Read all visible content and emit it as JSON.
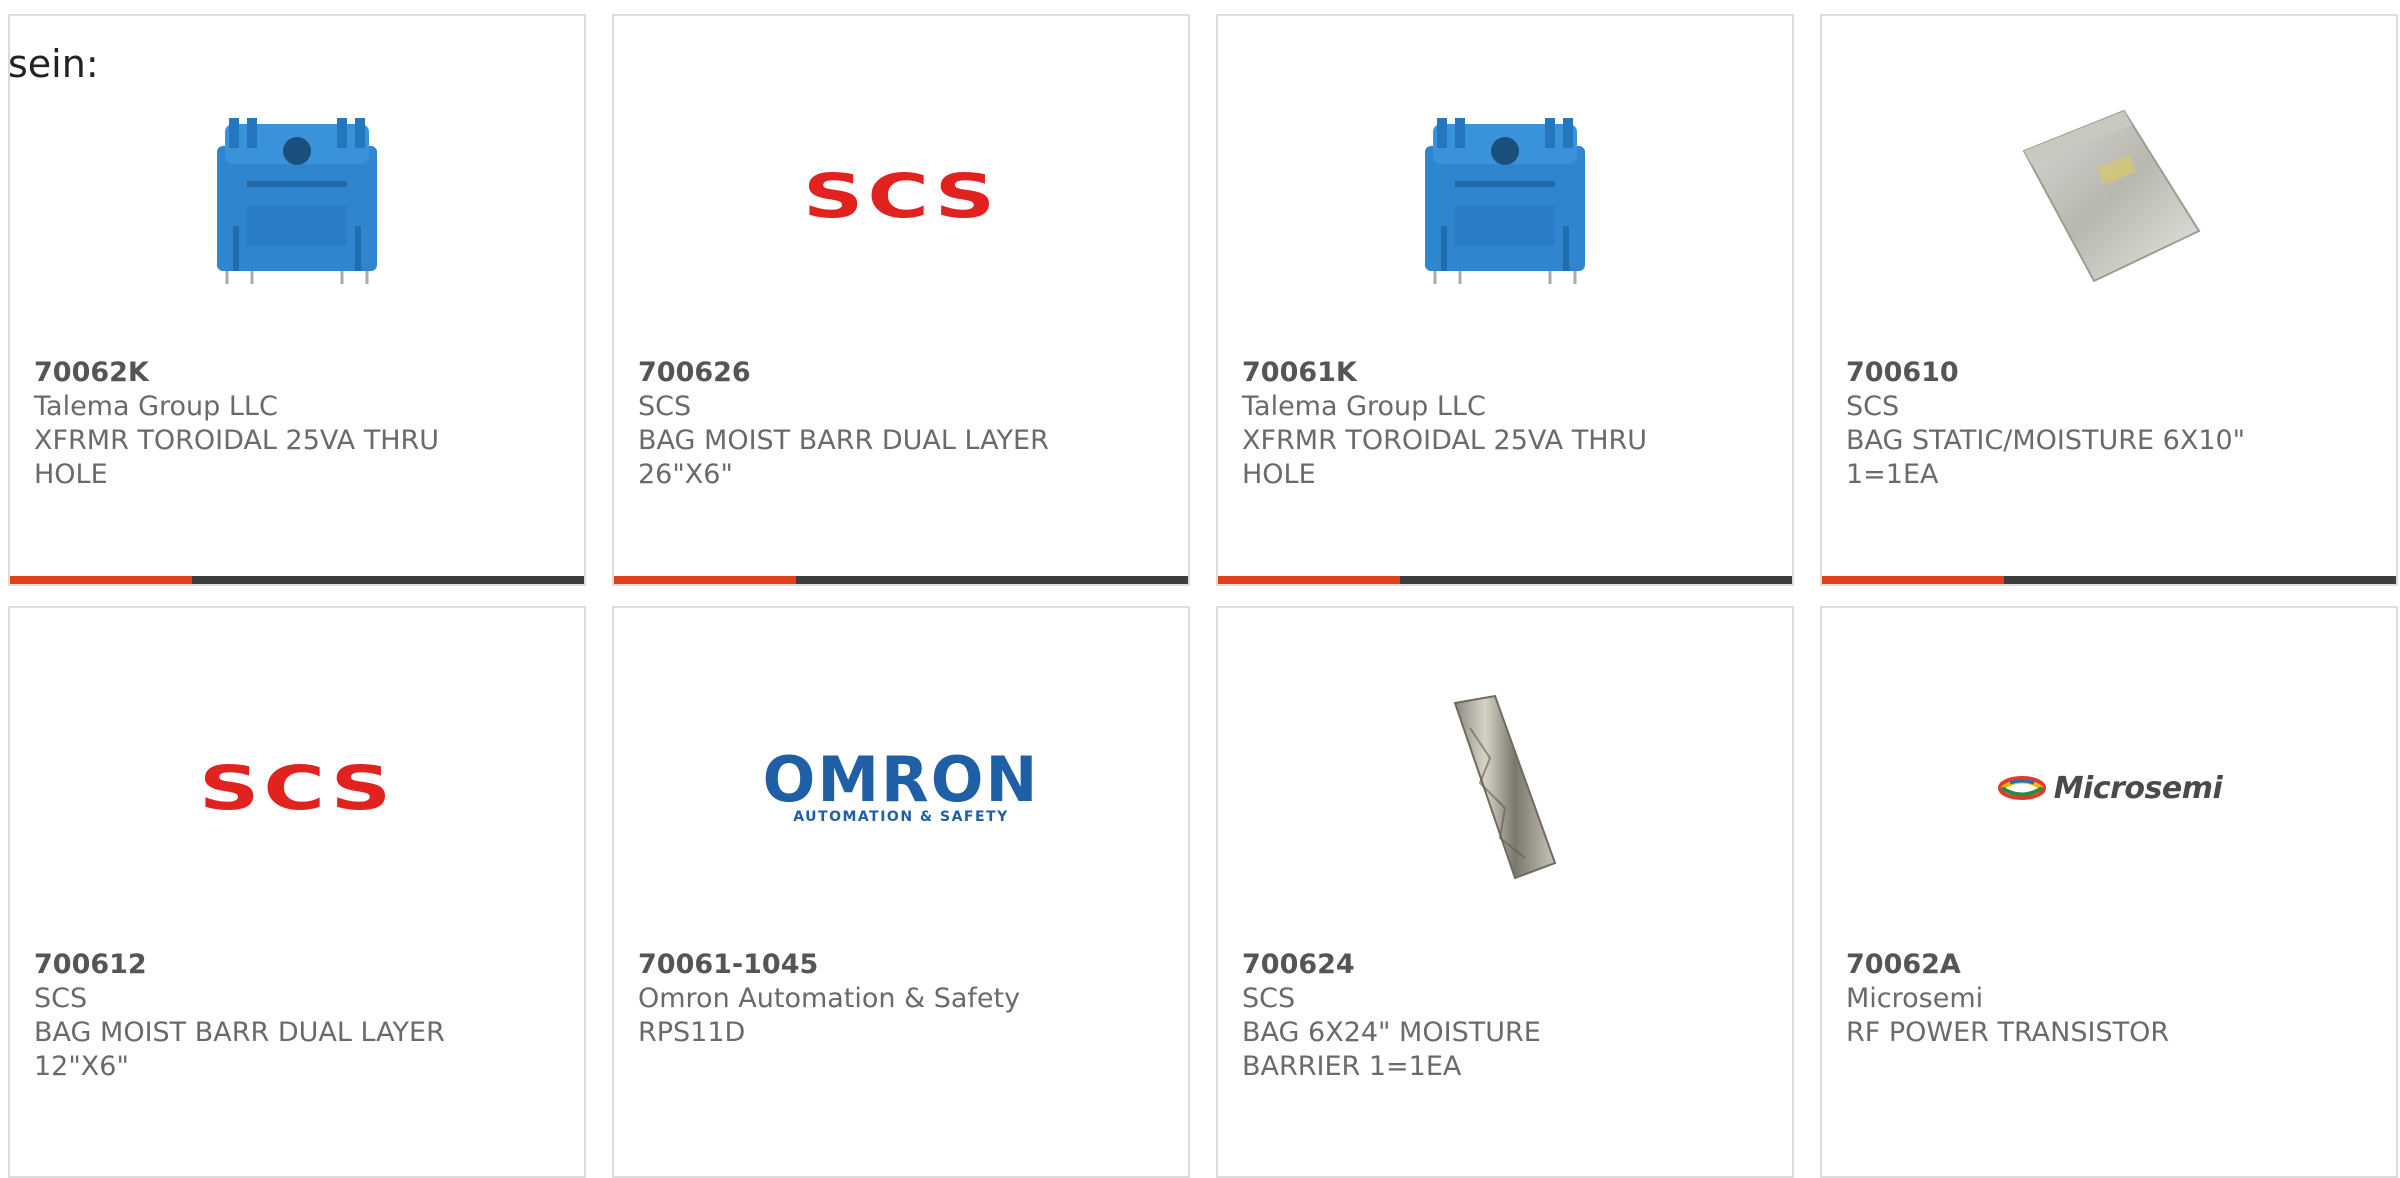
{
  "header": {
    "label": "sein:"
  },
  "colors": {
    "accent": "#e0401a",
    "bar": "#3d3d3d",
    "card_border": "#dcdcdc"
  },
  "products": [
    {
      "part_number": "70062K",
      "manufacturer": "Talema Group LLC",
      "description": "XFRMR TOROIDAL 25VA THRU HOLE",
      "image": "blue-toroidal-transformer"
    },
    {
      "part_number": "700626",
      "manufacturer": "SCS",
      "description": "BAG MOIST BARR DUAL LAYER 26\"X6\"",
      "image": "scs-logo",
      "logo_text": "SCS"
    },
    {
      "part_number": "70061K",
      "manufacturer": "Talema Group LLC",
      "description": "XFRMR TOROIDAL 25VA THRU HOLE",
      "image": "blue-toroidal-transformer"
    },
    {
      "part_number": "700610",
      "manufacturer": "SCS",
      "description": "BAG STATIC/MOISTURE 6X10\" 1=1EA",
      "image": "static-shielding-bag"
    },
    {
      "part_number": "700612",
      "manufacturer": "SCS",
      "description": "BAG MOIST BARR DUAL LAYER 12\"X6\"",
      "image": "scs-logo",
      "logo_text": "SCS"
    },
    {
      "part_number": "70061-1045",
      "manufacturer": "Omron Automation & Safety",
      "description": "RPS11D",
      "image": "omron-logo",
      "logo_text": "OMRON",
      "logo_sub": "AUTOMATION & SAFETY"
    },
    {
      "part_number": "700624",
      "manufacturer": "SCS",
      "description": "BAG 6X24\" MOISTURE BARRIER 1=1EA",
      "image": "moisture-barrier-bag"
    },
    {
      "part_number": "70062A",
      "manufacturer": "Microsemi",
      "description": "RF POWER TRANSISTOR",
      "image": "microsemi-logo",
      "logo_text": "Microsemi"
    }
  ]
}
